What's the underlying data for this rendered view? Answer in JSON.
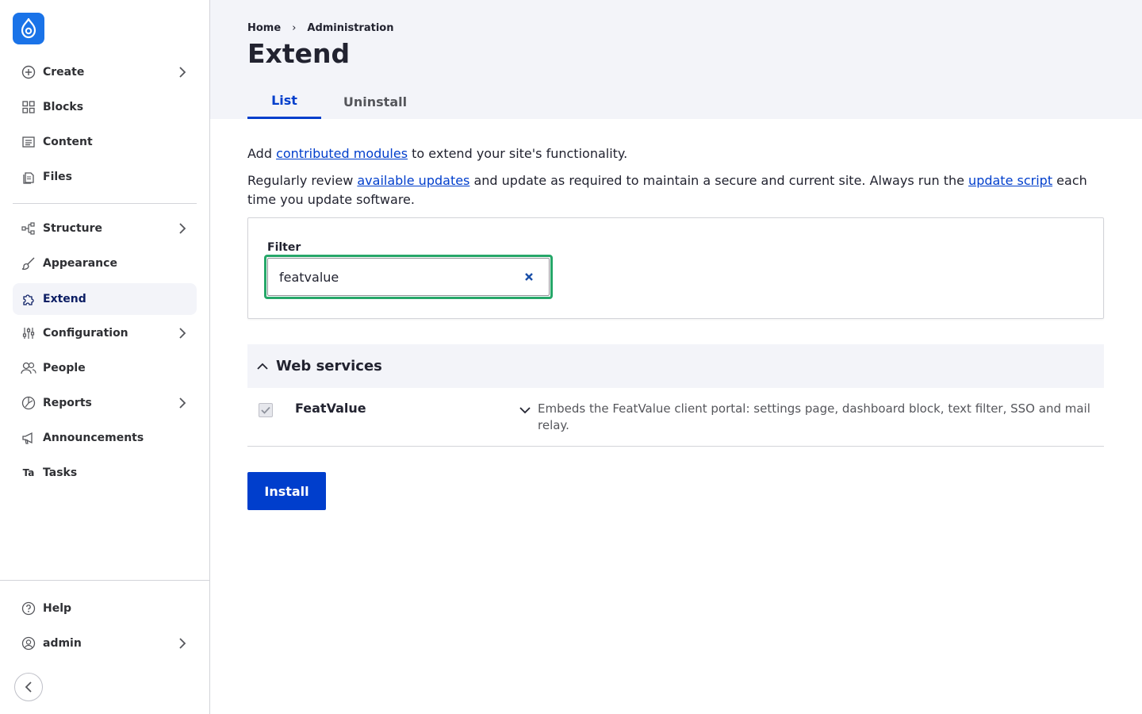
{
  "sidebar": {
    "logo_icon": "drupal-drop-icon",
    "items": [
      {
        "label": "Create",
        "icon": "plus-circle-icon",
        "has_submenu": true
      },
      {
        "label": "Blocks",
        "icon": "grid-icon",
        "has_submenu": false
      },
      {
        "label": "Content",
        "icon": "document-lines-icon",
        "has_submenu": false
      },
      {
        "label": "Files",
        "icon": "files-icon",
        "has_submenu": false
      },
      {
        "label": "Structure",
        "icon": "structure-icon",
        "has_submenu": true
      },
      {
        "label": "Appearance",
        "icon": "brush-icon",
        "has_submenu": false
      },
      {
        "label": "Extend",
        "icon": "puzzle-icon",
        "has_submenu": false,
        "active": true
      },
      {
        "label": "Configuration",
        "icon": "sliders-icon",
        "has_submenu": true
      },
      {
        "label": "People",
        "icon": "people-icon",
        "has_submenu": false
      },
      {
        "label": "Reports",
        "icon": "chart-icon",
        "has_submenu": true
      },
      {
        "label": "Announcements",
        "icon": "megaphone-icon",
        "has_submenu": false
      },
      {
        "label": "Tasks",
        "icon": "ta-icon",
        "icon_text": "Ta",
        "has_submenu": false
      }
    ],
    "bottom": [
      {
        "label": "Help",
        "icon": "help-icon",
        "has_submenu": false
      },
      {
        "label": "admin",
        "icon": "user-icon",
        "has_submenu": true
      }
    ]
  },
  "header": {
    "breadcrumb": [
      "Home",
      "Administration"
    ],
    "breadcrumb_separator": "›",
    "title": "Extend",
    "tabs": [
      {
        "label": "List",
        "active": true
      },
      {
        "label": "Uninstall",
        "active": false
      }
    ]
  },
  "main": {
    "intro1": {
      "before": "Add ",
      "link": "contributed modules",
      "after": " to extend your site's functionality."
    },
    "intro2": {
      "before": "Regularly review ",
      "link1": "available updates",
      "middle": " and update as required to maintain a secure and current site. Always run the ",
      "link2": "update script",
      "after": " each time you update software."
    },
    "filter": {
      "label": "Filter",
      "value": "featvalue"
    },
    "group": {
      "title": "Web services",
      "expanded": true,
      "modules": [
        {
          "name": "FeatValue",
          "checked": true,
          "disabled": true,
          "description": "Embeds the FeatValue client portal: settings page, dashboard block, text filter, SSO and mail relay."
        }
      ]
    },
    "install_label": "Install"
  },
  "colors": {
    "accent": "#003ecc",
    "logo": "#1a73e8",
    "focus_ring": "#26a769",
    "header_bg": "#f3f4f9"
  }
}
